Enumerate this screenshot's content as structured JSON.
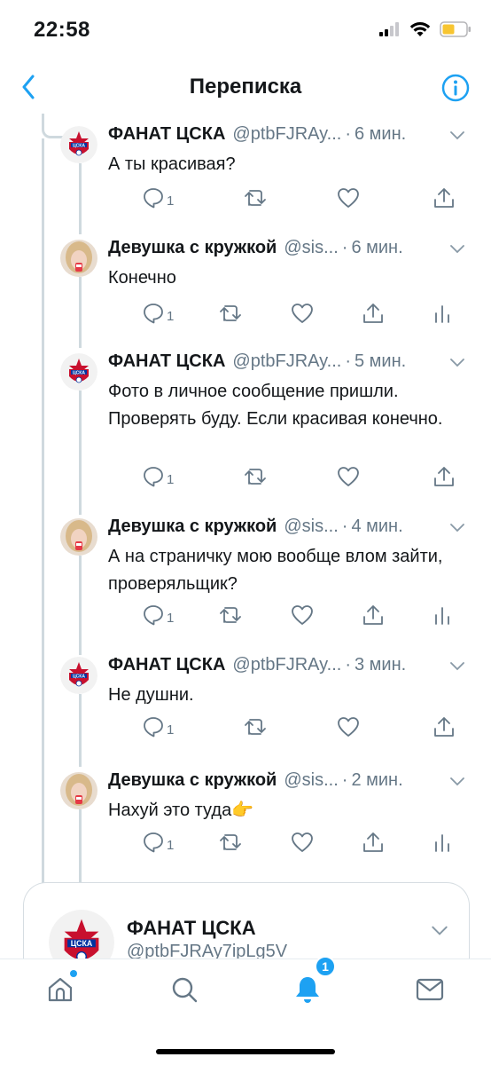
{
  "status_bar": {
    "time": "22:58"
  },
  "nav": {
    "title": "Переписка"
  },
  "tweets": [
    {
      "name": "ФАНАТ ЦСКА",
      "handle": "@ptbFJRAy...",
      "dot": "·",
      "time": "6 мин.",
      "text": "А ты красивая?",
      "reply_count": "1",
      "avatar": "cska-logo",
      "analytics": false
    },
    {
      "name": "Девушка с кружкой",
      "handle": "@sis...",
      "dot": "·",
      "time": "6 мин.",
      "text": "Конечно",
      "reply_count": "1",
      "avatar": "girl-photo",
      "analytics": true
    },
    {
      "name": "ФАНАТ ЦСКА",
      "handle": "@ptbFJRAy...",
      "dot": "·",
      "time": "5 мин.",
      "text": "Фото в личное сообщение пришли. Проверять буду. Если красивая конечно.",
      "reply_count": "1",
      "avatar": "cska-logo",
      "analytics": false
    },
    {
      "name": "Девушка с кружкой",
      "handle": "@sis...",
      "dot": "·",
      "time": "4 мин.",
      "text": "А на страничку мою вообще влом зайти, проверяльщик?",
      "reply_count": "1",
      "avatar": "girl-photo",
      "analytics": true
    },
    {
      "name": "ФАНАТ ЦСКА",
      "handle": "@ptbFJRAy...",
      "dot": "·",
      "time": "3 мин.",
      "text": "Не душни.",
      "reply_count": "1",
      "avatar": "cska-logo",
      "analytics": false
    },
    {
      "name": "Девушка с кружкой",
      "handle": "@sis...",
      "dot": "·",
      "time": "2 мин.",
      "text": "Нахуй это туда👉",
      "reply_count": "1",
      "avatar": "girl-photo",
      "analytics": true
    }
  ],
  "focused": {
    "name": "ФАНАТ ЦСКА",
    "handle": "@ptbFJRAy7ipLg5V"
  },
  "tab_bar": {
    "notifications_badge": "1"
  },
  "colors": {
    "accent": "#1da1f2",
    "text": "#14171a",
    "secondary": "#657786",
    "line": "#cfd9de",
    "cska_red": "#c8102e",
    "cska_blue": "#0033a0"
  },
  "icons": [
    "chevron-left-icon",
    "info-icon",
    "reply-icon",
    "retweet-icon",
    "like-icon",
    "share-icon",
    "analytics-icon",
    "home-icon",
    "search-icon",
    "bell-icon",
    "mail-icon"
  ]
}
